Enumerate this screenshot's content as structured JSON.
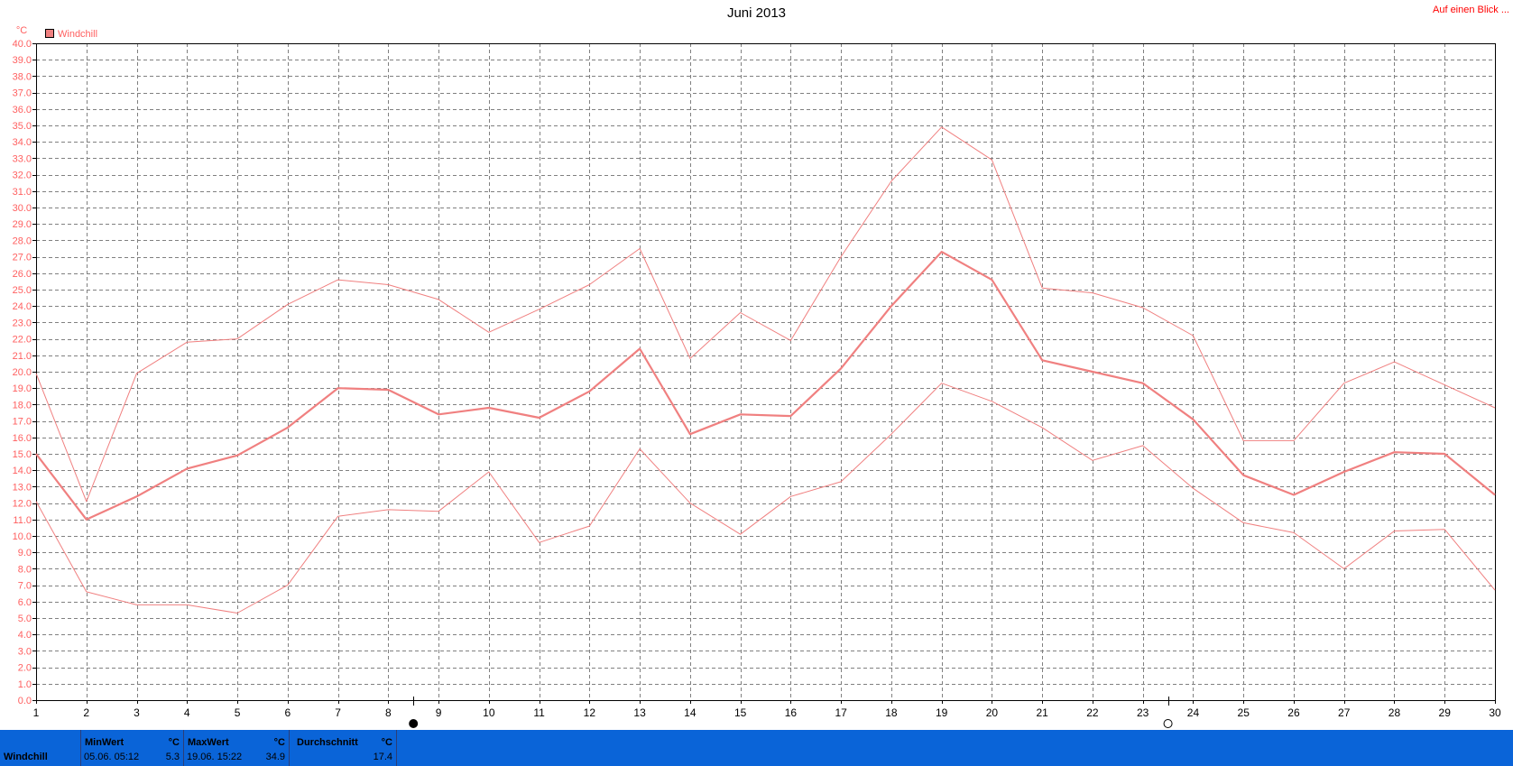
{
  "header": {
    "title": "Juni 2013",
    "link": "Auf einen Blick ..."
  },
  "colors": {
    "series": "#f08080",
    "axis_text": "#ff6060",
    "footer_bg": "#0a64d8"
  },
  "chart_data": {
    "type": "line",
    "title": "Juni 2013",
    "ylabel": "°C",
    "ylim": [
      0,
      40
    ],
    "y_tick_step": 1,
    "x": [
      1,
      2,
      3,
      4,
      5,
      6,
      7,
      8,
      9,
      10,
      11,
      12,
      13,
      14,
      15,
      16,
      17,
      18,
      19,
      20,
      21,
      22,
      23,
      24,
      25,
      26,
      27,
      28,
      29,
      30
    ],
    "legend": "Windchill",
    "grid": true,
    "series": [
      {
        "name": "Windchill",
        "role": "max",
        "values": [
          19.9,
          12.1,
          19.9,
          21.8,
          22.0,
          24.1,
          25.6,
          25.3,
          24.4,
          22.4,
          23.8,
          25.3,
          27.5,
          20.8,
          23.6,
          21.9,
          27.0,
          31.6,
          34.9,
          32.9,
          25.1,
          24.8,
          23.9,
          22.2,
          15.8,
          15.8,
          19.3,
          20.6,
          19.2,
          17.8
        ]
      },
      {
        "name": "Windchill",
        "role": "avg",
        "values": [
          15.0,
          11.0,
          12.4,
          14.1,
          14.9,
          16.6,
          19.0,
          18.9,
          17.4,
          17.8,
          17.2,
          18.8,
          21.4,
          16.2,
          17.4,
          17.3,
          20.2,
          24.0,
          27.3,
          25.6,
          20.7,
          20.0,
          19.3,
          17.1,
          13.7,
          12.5,
          13.9,
          15.1,
          15.0,
          12.5
        ]
      },
      {
        "name": "Windchill",
        "role": "min",
        "values": [
          12.1,
          6.6,
          5.8,
          5.8,
          5.3,
          7.0,
          11.2,
          11.6,
          11.5,
          13.9,
          9.6,
          10.6,
          15.3,
          12.0,
          10.1,
          12.4,
          13.3,
          16.2,
          19.3,
          18.2,
          16.6,
          14.6,
          15.5,
          12.9,
          10.8,
          10.2,
          8.0,
          10.3,
          10.4,
          6.7
        ]
      }
    ],
    "moon_markers": [
      {
        "day": 9,
        "phase": "full-moon-icon"
      },
      {
        "day": 24,
        "phase": "new-moon-icon"
      }
    ]
  },
  "footer": {
    "series_label": "Windchill",
    "min": {
      "label": "MinWert",
      "unit": "°C",
      "date": "05.06.  05:12",
      "value": "5.3"
    },
    "max": {
      "label": "MaxWert",
      "unit": "°C",
      "date": "19.06.  15:22",
      "value": "34.9"
    },
    "avg": {
      "label": "Durchschnitt",
      "unit": "°C",
      "value": "17.4"
    }
  }
}
